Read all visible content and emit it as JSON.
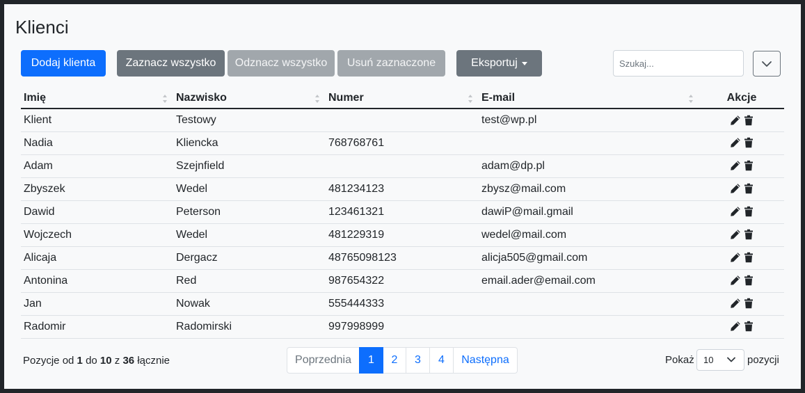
{
  "page": {
    "title": "Klienci"
  },
  "toolbar": {
    "add_label": "Dodaj klienta",
    "select_all_label": "Zaznacz wszystko",
    "deselect_all_label": "Odznacz wszystko",
    "delete_selected_label": "Usuń zaznaczone",
    "export_label": "Eksportuj"
  },
  "search": {
    "placeholder": "Szukaj...",
    "value": ""
  },
  "table": {
    "columns": [
      "Imię",
      "Nazwisko",
      "Numer",
      "E-mail",
      "Akcje"
    ],
    "rows": [
      [
        "Klient",
        "Testowy",
        "",
        "test@wp.pl"
      ],
      [
        "Nadia",
        "Kliencka",
        "768768761",
        ""
      ],
      [
        "Adam",
        "Szejnfield",
        "",
        "adam@dp.pl"
      ],
      [
        "Zbyszek",
        "Wedel",
        "481234123",
        "zbysz@mail.com"
      ],
      [
        "Dawid",
        "Peterson",
        "123461321",
        "dawiP@mail.gmail"
      ],
      [
        "Wojczech",
        "Wedel",
        "481229319",
        "wedel@mail.com"
      ],
      [
        "Alicaja",
        "Dergacz",
        "48765098123",
        "alicja505@gmail.com"
      ],
      [
        "Antonina",
        "Red",
        "987654322",
        "email.ader@email.com"
      ],
      [
        "Jan",
        "Nowak",
        "555444333",
        ""
      ],
      [
        "Radomir",
        "Radomirski",
        "997998999",
        ""
      ]
    ],
    "row_actions": [
      "edit-icon",
      "trash-icon"
    ]
  },
  "footer": {
    "info_prefix": "Pozycje od",
    "info_from": "1",
    "info_to_word": "do",
    "info_to": "10",
    "info_of_word": "z",
    "info_total": "36",
    "info_suffix": "łącznie",
    "pagination": {
      "prev_label": "Poprzednia",
      "pages": [
        "1",
        "2",
        "3",
        "4"
      ],
      "active_page": "1",
      "next_label": "Następna"
    },
    "show_label": "Pokaż",
    "page_size": "10",
    "after_label": "pozycji"
  },
  "colors": {
    "primary": "#0d6efd",
    "secondary": "#6c757d",
    "background": "#f8f9fa",
    "frame": "#212529"
  }
}
